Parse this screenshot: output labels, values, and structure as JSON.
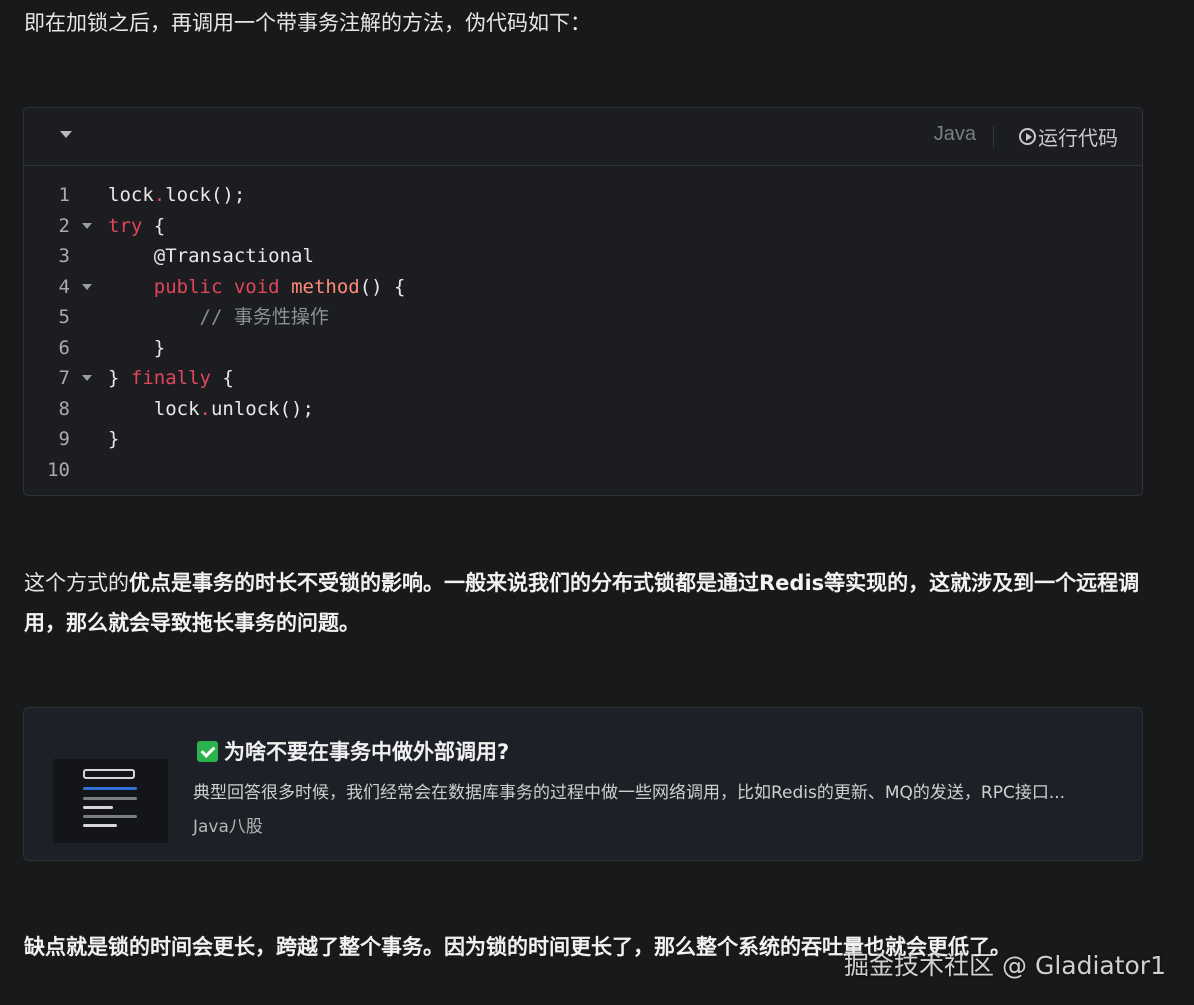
{
  "intro_text": "即在加锁之后，再调用一个带事务注解的方法，伪代码如下：",
  "code_block": {
    "language": "Java",
    "run_label": "运行代码",
    "lines": [
      {
        "num": "1",
        "foldable": false,
        "tokens": [
          {
            "t": "lock",
            "c": "pl"
          },
          {
            "t": ".",
            "c": "dot"
          },
          {
            "t": "lock();",
            "c": "pl"
          }
        ]
      },
      {
        "num": "2",
        "foldable": true,
        "tokens": [
          {
            "t": "try",
            "c": "kw"
          },
          {
            "t": " {",
            "c": "pl"
          }
        ]
      },
      {
        "num": "3",
        "foldable": false,
        "tokens": [
          {
            "t": "    @Transactional",
            "c": "pl"
          }
        ]
      },
      {
        "num": "4",
        "foldable": true,
        "tokens": [
          {
            "t": "    ",
            "c": "pl"
          },
          {
            "t": "public",
            "c": "kw"
          },
          {
            "t": " ",
            "c": "pl"
          },
          {
            "t": "void",
            "c": "kw"
          },
          {
            "t": " ",
            "c": "pl"
          },
          {
            "t": "method",
            "c": "fn"
          },
          {
            "t": "() {",
            "c": "pl"
          }
        ]
      },
      {
        "num": "5",
        "foldable": false,
        "tokens": [
          {
            "t": "        // 事务性操作",
            "c": "cm"
          }
        ]
      },
      {
        "num": "6",
        "foldable": false,
        "tokens": [
          {
            "t": "    }",
            "c": "pl"
          }
        ]
      },
      {
        "num": "7",
        "foldable": true,
        "tokens": [
          {
            "t": "} ",
            "c": "pl"
          },
          {
            "t": "finally",
            "c": "kw"
          },
          {
            "t": " {",
            "c": "pl"
          }
        ]
      },
      {
        "num": "8",
        "foldable": false,
        "tokens": [
          {
            "t": "    lock",
            "c": "pl"
          },
          {
            "t": ".",
            "c": "dot"
          },
          {
            "t": "unlock();",
            "c": "pl"
          }
        ]
      },
      {
        "num": "9",
        "foldable": false,
        "tokens": [
          {
            "t": "}",
            "c": "pl"
          }
        ]
      },
      {
        "num": "10",
        "foldable": false,
        "tokens": []
      }
    ]
  },
  "advantage": {
    "prefix": "这个方式的",
    "bold": "优点是事务的时长不受锁的影响。一般来说我们的分布式锁都是通过Redis等实现的，这就涉及到一个远程调用，那么就会导致拖长事务的问题。"
  },
  "link_card": {
    "title": "为啥不要在事务中做外部调用?",
    "description": "典型回答很多时候，我们经常会在数据库事务的过程中做一些网络调用，比如Redis的更新、MQ的发送，RPC接口...",
    "source": "Java八股",
    "thumb_icon": "document-thumbnail-icon",
    "check_color": "#2bb24c"
  },
  "disadvantage": "缺点就是锁的时间会更长，跨越了整个事务。因为锁的时间更长了，那么整个系统的吞吐量也就会更低了。",
  "watermark": "掘金技术社区 @ Gladiator1",
  "colors": {
    "background": "#18191b",
    "keyword": "#e0465a",
    "function": "#ff8a7a",
    "comment": "#8c8f94"
  }
}
